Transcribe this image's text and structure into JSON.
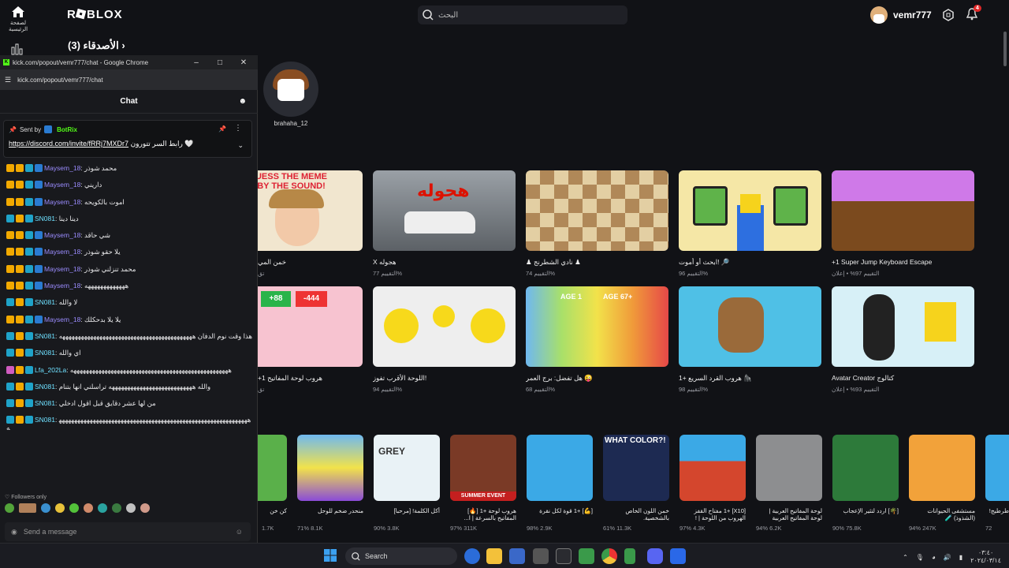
{
  "roblox": {
    "logo": "R⬛BLOX",
    "home_label": "لصفحة الرئيسية",
    "search_placeholder": "البحث",
    "username": "vemr777",
    "notification_count": "4",
    "friends_heading": "الأصدقاء (3)",
    "friend_name": "brahaha_12",
    "row1": [
      {
        "title": "خمن المي",
        "rating": "تق"
      },
      {
        "title": "X هجوله",
        "rating": "التقييم 77%"
      },
      {
        "title": "♟ نادي الشطرنج ♟",
        "rating": "التقييم 74%"
      },
      {
        "title": "ابحث أو أموت! 🔎",
        "rating": "التقييم 96%"
      },
      {
        "title": "+1 Super Jump Keyboard Escape",
        "rating": "التقييم 97% • إعلان"
      }
    ],
    "row2": [
      {
        "title": "+1 هروب لوحة المفاتيح",
        "rating": "تق"
      },
      {
        "title": "اللوحة الأقرب تفوز!",
        "rating": "التقييم 94%"
      },
      {
        "title": "هل تفضل: برج العمر 😜",
        "rating": "التقييم 68%"
      },
      {
        "title": "هروب القرد السريع +1 🦍",
        "rating": "التقييم 98%"
      },
      {
        "title": "Avatar Creator كتالوج",
        "rating": "التقييم 93% • إعلان"
      }
    ],
    "row3": [
      {
        "title": "كن خن",
        "rating": "1.7K"
      },
      {
        "title": "منحدر ضخم للوحل",
        "rating": "71%  8.1K"
      },
      {
        "title": "أكل الكلمة! [مرحبا]",
        "rating": "90%  3.8K"
      },
      {
        "title": "هروب لوحة +1 [🔥] المفاتيح بالسرعة | ا...",
        "rating": "97%  311K"
      },
      {
        "title": "[💪] +1 قوة لكل نقرة",
        "rating": "98%  2.9K"
      },
      {
        "title": "خمن اللون الخاص بالشخصية.",
        "rating": "61%  11.3K"
      },
      {
        "title": "[X10] +1 مفتاح القفز الهروب من اللوحة | !",
        "rating": "97%  4.3K"
      },
      {
        "title": "لوحة المفاتيح العربية | لوحة المفاتيح العربية",
        "rating": "94%  6.2K"
      },
      {
        "title": "[🌴] اردد لتثير الإعجاب",
        "rating": "90%  75.8K"
      },
      {
        "title": "مستشفى الحيوانات (الشذوذ) 🧪",
        "rating": "94%  247K"
      },
      {
        "title": "طرطيج!",
        "rating": "72"
      }
    ]
  },
  "popup": {
    "window_title": "kick.com/popout/vemr777/chat - Google Chrome",
    "url": "kick.com/popout/vemr777/chat",
    "chat_title": "Chat",
    "pinned_sent_by": "Sent by",
    "pinned_user": "BotRix",
    "pinned_link": "https://discord.com/invite/fRRj7MXDr7",
    "pinned_text": "رابط السر تتورون 🤍",
    "messages": [
      {
        "user": "Maysem_18",
        "color": "#9b8cff",
        "badges": "kcgv",
        "text": "محمد شوذر"
      },
      {
        "user": "Maysem_18",
        "color": "#9b8cff",
        "badges": "kcgv",
        "text": "داريني"
      },
      {
        "user": "Maysem_18",
        "color": "#9b8cff",
        "badges": "kcgv",
        "text": "اموت بالكويحه"
      },
      {
        "user": "SN081",
        "color": "#6ee0ff",
        "badges": "gcg",
        "text": "دينا دينا"
      },
      {
        "user": "Maysem_18",
        "color": "#9b8cff",
        "badges": "kcgv",
        "text": "شي حاقد"
      },
      {
        "user": "Maysem_18",
        "color": "#9b8cff",
        "badges": "kcgv",
        "text": "يلا حقو شوذر"
      },
      {
        "user": "Maysem_18",
        "color": "#9b8cff",
        "badges": "kcgv",
        "text": "محمد تنزلني شوذر"
      },
      {
        "user": "Maysem_18",
        "color": "#9b8cff",
        "badges": "kcgv",
        "text": "هههههههههههههه"
      },
      {
        "user": "SN081",
        "color": "#6ee0ff",
        "badges": "gcg",
        "text": "لا والله"
      },
      {
        "user": "Maysem_18",
        "color": "#9b8cff",
        "badges": "kcgv",
        "text": "يلا يلا بدحكلك"
      },
      {
        "user": "SN081",
        "color": "#6ee0ff",
        "badges": "gcg",
        "text": "هذا وقت نوم الدفان هههههههههههههههههههههههههههههههههههههههههههه"
      },
      {
        "user": "SN081",
        "color": "#6ee0ff",
        "badges": "gcg",
        "text": "اي والله"
      },
      {
        "user": "Lfa_202La",
        "color": "#6ee0ff",
        "badges": "pcg",
        "text": "هههههههههههههههههههههههههههههههههههههههههههههههههههه"
      },
      {
        "user": "SN081",
        "color": "#6ee0ff",
        "badges": "gcg",
        "text": "والله هههههههههههههههههههههههههههه تراسلني انها بتنام"
      },
      {
        "user": "SN081",
        "color": "#6ee0ff",
        "badges": "gcg",
        "text": "من لها عشر دقايق قبل اقول ادخلي"
      },
      {
        "user": "SN081",
        "color": "#6ee0ff",
        "badges": "gcg",
        "text": "ههههههههههههههههههههههههههههههههههههههههههههههههههههههههههههههه"
      }
    ],
    "followers_only": "Followers only",
    "send_placeholder": "Send a message"
  },
  "taskbar": {
    "search_label": "Search",
    "clock_time": "٠٣:٤٠",
    "clock_date": "٢٠٢٤/٠٣/١٤"
  }
}
